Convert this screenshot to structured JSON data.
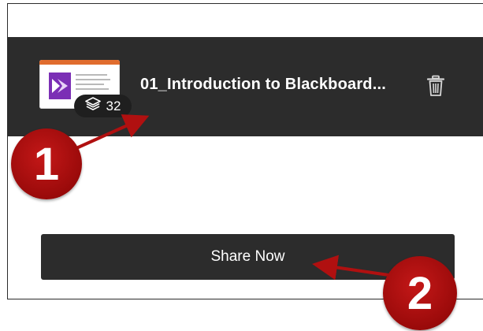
{
  "file": {
    "name": "01_Introduction to Blackboard...",
    "page_count": "32",
    "thumbnail_icon": "document-thumbnail",
    "badge_icon": "layers-icon",
    "delete_icon": "trash-icon"
  },
  "actions": {
    "share_label": "Share Now"
  },
  "callouts": [
    {
      "number": "1",
      "color": "#b01010"
    },
    {
      "number": "2",
      "color": "#b01010"
    }
  ],
  "colors": {
    "bar_background": "#2c2c2c",
    "button_background": "#2c2c2c",
    "text_on_dark": "#ffffff",
    "callout_red": "#b01010",
    "thumbnail_accent": "#7b2fb5",
    "thumbnail_stripe": "#e06c2e"
  }
}
